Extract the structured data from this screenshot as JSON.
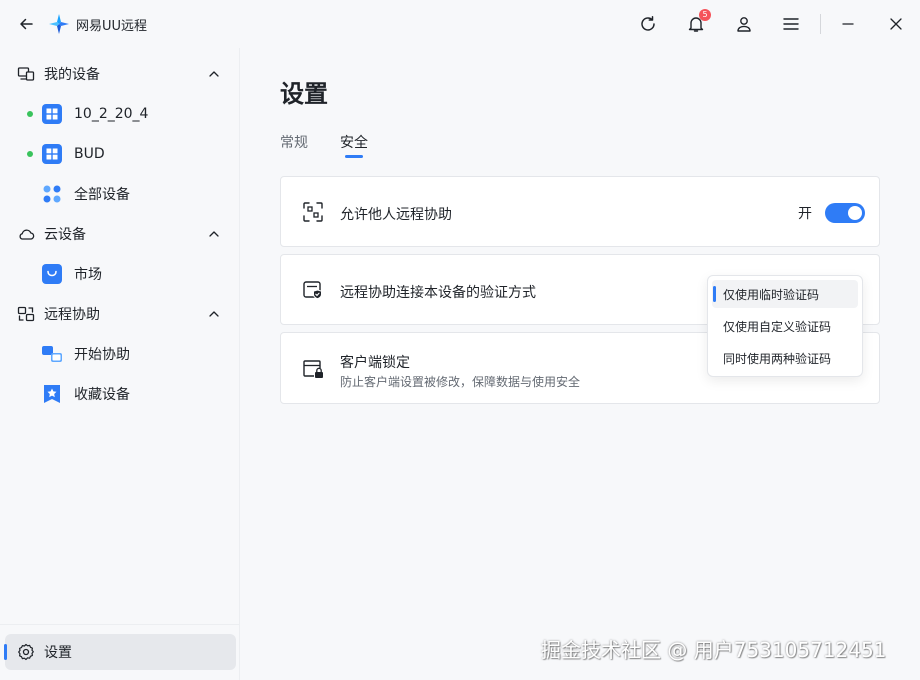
{
  "app": {
    "title": "网易UU远程"
  },
  "titlebar": {
    "notification_count": "5"
  },
  "sidebar": {
    "groups": [
      {
        "label": "我的设备",
        "items": [
          {
            "label": "10_2_20_4",
            "online": true
          },
          {
            "label": "BUD",
            "online": true
          },
          {
            "label": "全部设备"
          }
        ]
      },
      {
        "label": "云设备",
        "items": [
          {
            "label": "市场"
          }
        ]
      },
      {
        "label": "远程协助",
        "items": [
          {
            "label": "开始协助"
          },
          {
            "label": "收藏设备"
          }
        ]
      }
    ],
    "settings_label": "设置"
  },
  "main": {
    "title": "设置",
    "tabs": [
      {
        "label": "常规"
      },
      {
        "label": "安全",
        "active": true
      }
    ],
    "cards": [
      {
        "title": "允许他人远程协助",
        "toggle_label": "开",
        "toggle_on": true
      },
      {
        "title": "远程协助连接本设备的验证方式"
      },
      {
        "title": "客户端锁定",
        "subtitle": "防止客户端设置被修改，保障数据与使用安全"
      }
    ],
    "dropdown_options": [
      "仅使用临时验证码",
      "仅使用自定义验证码",
      "同时使用两种验证码"
    ],
    "dropdown_selected": "仅使用临时验证码"
  },
  "watermark": "掘金技术社区 @ 用户753105712451",
  "colors": {
    "accent": "#2f7cf6",
    "online": "#3ac35c",
    "badge": "#f5535a"
  }
}
